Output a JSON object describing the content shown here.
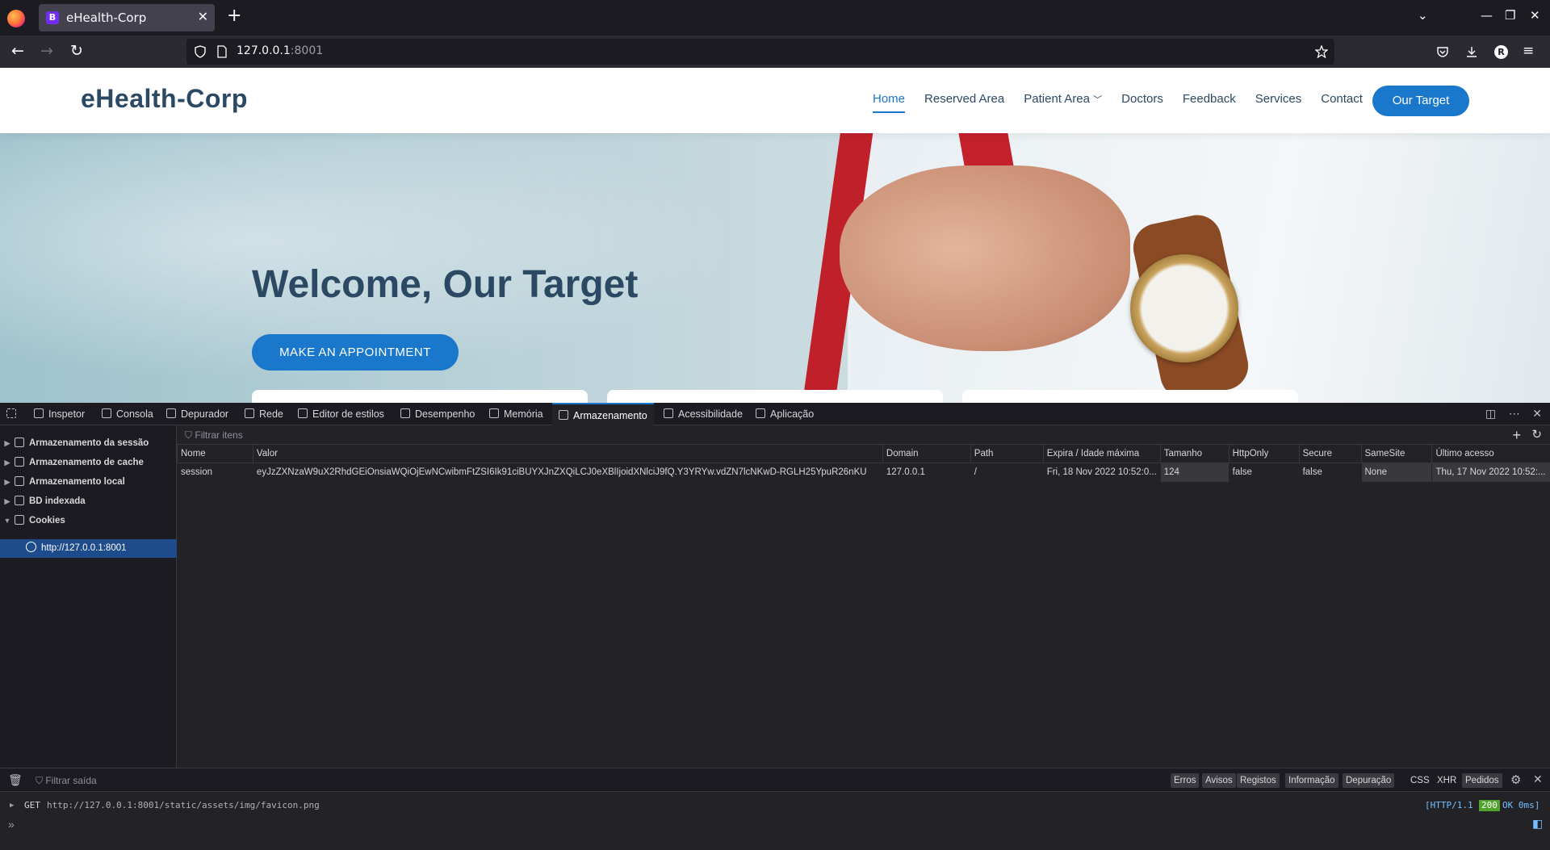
{
  "browser": {
    "tab_title": "eHealth-Corp",
    "tab_favicon_letter": "B",
    "url_host": "127.0.0.1",
    "url_port": ":8001",
    "avatar_letter": "R"
  },
  "site": {
    "logo": "eHealth-Corp",
    "nav": [
      "Home",
      "Reserved Area",
      "Patient Area",
      "Doctors",
      "Feedback",
      "Services",
      "Contact"
    ],
    "cta": "Our Target",
    "hero_title": "Welcome, Our Target",
    "appointment_button": "MAKE AN APPOINTMENT"
  },
  "devtools": {
    "tabs": [
      "Inspetor",
      "Consola",
      "Depurador",
      "Rede",
      "Editor de estilos",
      "Desempenho",
      "Memória",
      "Armazenamento",
      "Acessibilidade",
      "Aplicação"
    ],
    "active_tab": "Armazenamento",
    "tree": [
      "Armazenamento da sessão",
      "Armazenamento de cache",
      "Armazenamento local",
      "BD indexada",
      "Cookies"
    ],
    "selected_host": "http://127.0.0.1:8001",
    "filter_placeholder": "Filtrar itens",
    "columns": [
      "Nome",
      "Valor",
      "Domain",
      "Path",
      "Expira / Idade máxima",
      "Tamanho",
      "HttpOnly",
      "Secure",
      "SameSite",
      "Último acesso"
    ],
    "cookie": {
      "name": "session",
      "value": "eyJzZXNzaW9uX2RhdGEiOnsiaWQiOjEwNCwibmFtZSI6Ik91ciBUYXJnZXQiLCJ0eXBlIjoidXNlciJ9fQ.Y3YRYw.vdZN7lcNKwD-RGLH25YpuR26nKU",
      "domain": "127.0.0.1",
      "path": "/",
      "expires": "Fri, 18 Nov 2022 10:52:0...",
      "size": "124",
      "httponly": "false",
      "secure": "false",
      "samesite": "None",
      "last_accessed": "Thu, 17 Nov 2022 10:52:..."
    },
    "console": {
      "filter_placeholder": "Filtrar saída",
      "filters": [
        "Erros",
        "Avisos",
        "Registos",
        "Informação",
        "Depuração"
      ],
      "toggles": [
        "CSS",
        "XHR",
        "Pedidos"
      ],
      "log": {
        "method": "GET",
        "url": "http://127.0.0.1:8001/static/assets/img/favicon.png",
        "protocol": "[HTTP/1.1",
        "status": "200",
        "status_text": "OK 0ms]"
      }
    }
  }
}
